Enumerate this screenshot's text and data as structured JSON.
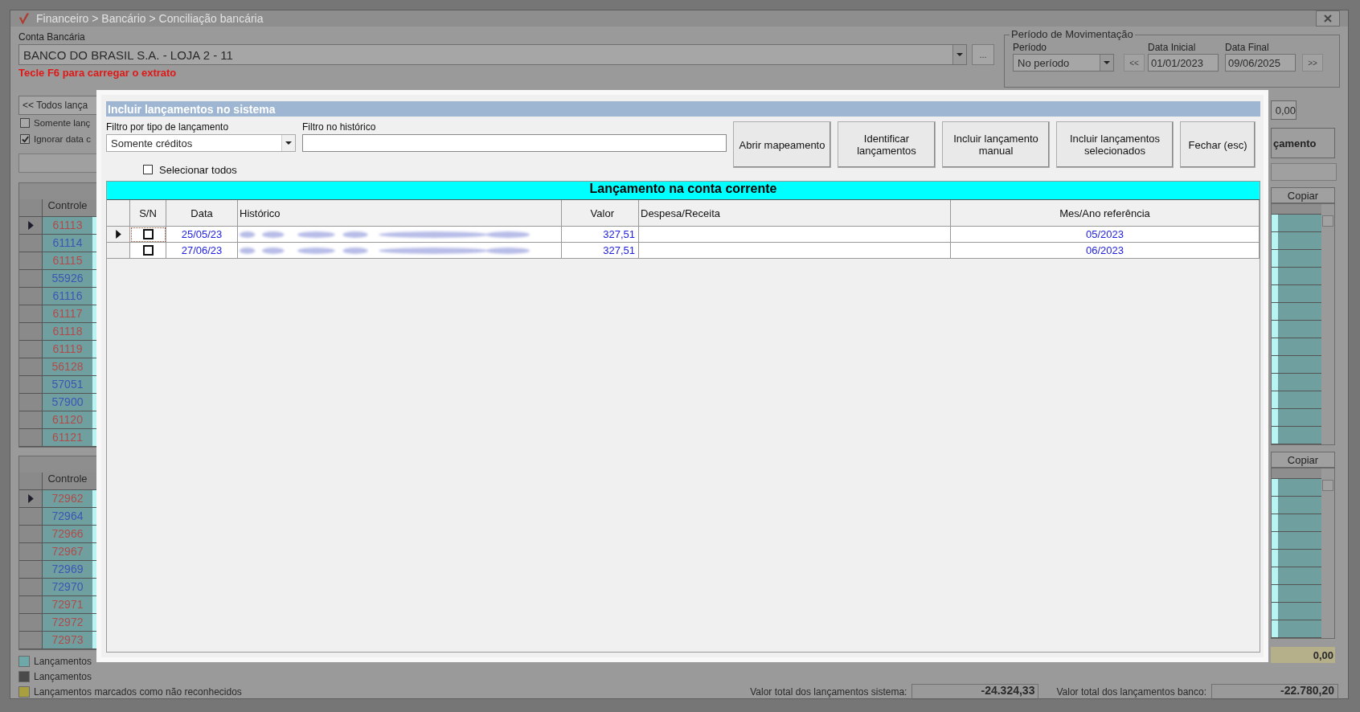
{
  "window": {
    "title": "Financeiro > Bancário > Conciliação bancária"
  },
  "account": {
    "label": "Conta Bancária",
    "value": "BANCO DO BRASIL S.A. - LOJA 2 - 11",
    "more_button": "..."
  },
  "hint": "Tecle F6 para carregar o extrato",
  "left_filter": {
    "value": "<< Todos lança"
  },
  "options": [
    {
      "label": "Somente lanç",
      "checked": false
    },
    {
      "label": "Ignorar data c",
      "checked": true
    }
  ],
  "period": {
    "title": "Período de Movimentação",
    "period_label": "Período",
    "period_value": "No período",
    "start_label": "Data Inicial",
    "start": "01/01/2023",
    "end_label": "Data Final",
    "end": "09/06/2025",
    "prev": "<<",
    "next": ">>",
    "value_field": "0,00"
  },
  "action_button": "çamento",
  "grid_top": {
    "column": "Controle",
    "copy_button": "Copiar",
    "rows": [
      {
        "id": "61113",
        "selected": true,
        "color": "#b34a4a"
      },
      {
        "id": "61114",
        "selected": false,
        "color": "#3c56b4"
      },
      {
        "id": "61115",
        "selected": false,
        "color": "#b34a4a"
      },
      {
        "id": "55926",
        "selected": false,
        "color": "#3c56b4"
      },
      {
        "id": "61116",
        "selected": false,
        "color": "#3c56b4"
      },
      {
        "id": "61117",
        "selected": false,
        "color": "#b34a4a"
      },
      {
        "id": "61118",
        "selected": false,
        "color": "#b34a4a"
      },
      {
        "id": "61119",
        "selected": false,
        "color": "#b34a4a"
      },
      {
        "id": "56128",
        "selected": false,
        "color": "#b34a4a"
      },
      {
        "id": "57051",
        "selected": false,
        "color": "#3c56b4"
      },
      {
        "id": "57900",
        "selected": false,
        "color": "#3c56b4"
      },
      {
        "id": "61120",
        "selected": false,
        "color": "#b34a4a"
      },
      {
        "id": "61121",
        "selected": false,
        "color": "#b34a4a"
      }
    ]
  },
  "grid_bottom": {
    "column": "Controle",
    "copy_button": "Copiar",
    "rows": [
      {
        "id": "72962",
        "selected": true,
        "color": "#b34a4a"
      },
      {
        "id": "72964",
        "selected": false,
        "color": "#3c56b4"
      },
      {
        "id": "72966",
        "selected": false,
        "color": "#b34a4a"
      },
      {
        "id": "72967",
        "selected": false,
        "color": "#b34a4a"
      },
      {
        "id": "72969",
        "selected": false,
        "color": "#3c56b4"
      },
      {
        "id": "72970",
        "selected": false,
        "color": "#3c56b4"
      },
      {
        "id": "72971",
        "selected": false,
        "color": "#b34a4a"
      },
      {
        "id": "72972",
        "selected": false,
        "color": "#b34a4a"
      },
      {
        "id": "72973",
        "selected": false,
        "color": "#b34a4a"
      }
    ]
  },
  "legend": [
    {
      "label": "Lançamentos",
      "color": "#6fa8a8"
    },
    {
      "label": "Lançamentos",
      "color": "#4a4a4a"
    },
    {
      "label": "Lançamentos marcados como não reconhecidos",
      "color": "#a8a040"
    }
  ],
  "totals": {
    "unrecognized": "0,00",
    "system_label": "Valor total dos lançamentos sistema:",
    "system": "-24.324,33",
    "bank_label": "Valor total dos lançamentos banco:",
    "bank": "-22.780,20"
  },
  "dialog": {
    "title": "Incluir lançamentos no sistema",
    "type_filter": {
      "label": "Filtro por tipo de lançamento",
      "value": "Somente créditos"
    },
    "history_filter": {
      "label": "Filtro no histórico"
    },
    "buttons": [
      "Abrir mapeamento",
      "Identificar lançamentos",
      "Incluir lançamento manual",
      "Incluir lançamentos selecionados",
      "Fechar (esc)"
    ],
    "select_all": {
      "label": "Selecionar todos",
      "checked": false
    },
    "grid_title": "Lançamento na conta corrente",
    "columns": [
      "S/N",
      "Data",
      "Histórico",
      "Valor",
      "Despesa/Receita",
      "Mes/Ano referência"
    ],
    "rows": [
      {
        "selected": true,
        "checked": false,
        "date": "25/05/23",
        "value": "327,51",
        "reference": "05/2023"
      },
      {
        "selected": false,
        "checked": false,
        "date": "27/06/23",
        "value": "327,51",
        "reference": "06/2023"
      }
    ]
  }
}
